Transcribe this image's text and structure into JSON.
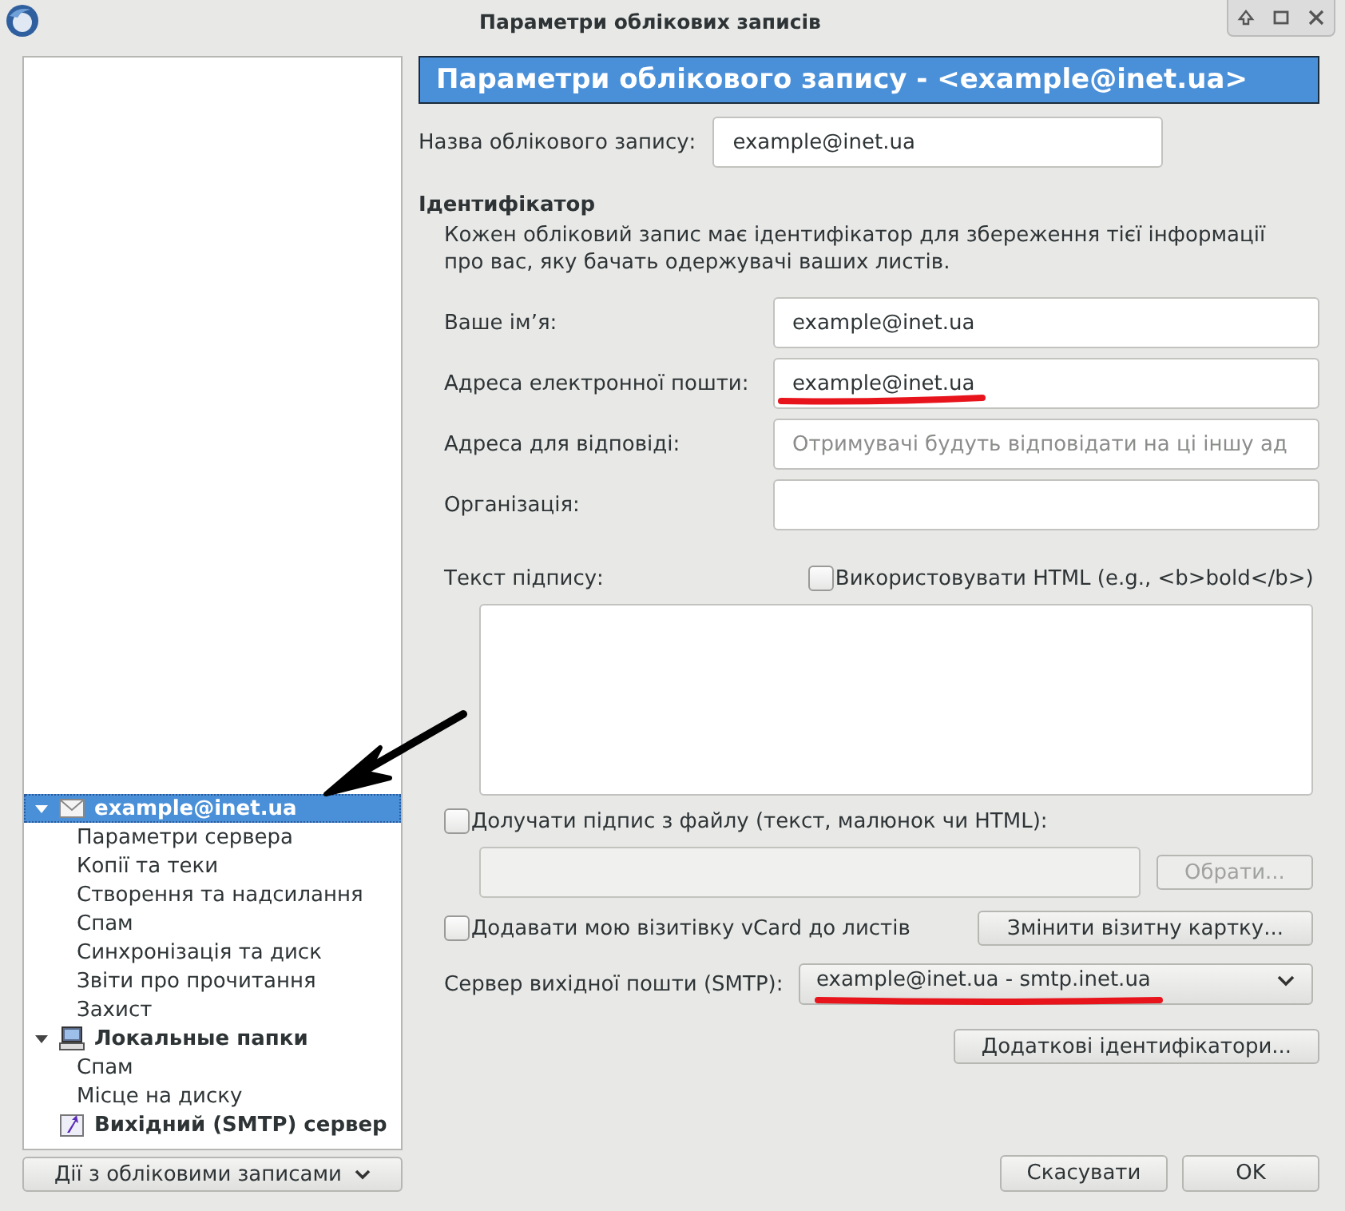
{
  "window": {
    "title": "Параметри облікових записів"
  },
  "tree": [
    {
      "label": "example@inet.ua",
      "kind": "account",
      "selected": true,
      "expanded": true,
      "children": [
        {
          "label": "Параметри сервера",
          "selected": false
        },
        {
          "label": "Копії та теки",
          "selected": false
        },
        {
          "label": "Створення та надсилання",
          "selected": false
        },
        {
          "label": "Спам",
          "selected": false
        },
        {
          "label": "Синхронізація та диск",
          "selected": false
        },
        {
          "label": "Звіти про прочитання",
          "selected": false
        },
        {
          "label": "Захист",
          "selected": false
        }
      ]
    },
    {
      "label": "Локальные папки",
      "kind": "local",
      "selected": false,
      "expanded": true,
      "children": [
        {
          "label": "Спам",
          "selected": false
        },
        {
          "label": "Місце на диску",
          "selected": false
        }
      ]
    },
    {
      "label": "Вихідний (SMTP) сервер",
      "kind": "smtp",
      "selected": false
    }
  ],
  "actions_button": "Дії з обліковими записами",
  "header": "Параметри облікового запису - <example@inet.ua>",
  "account_name": {
    "label": "Назва облікового запису:",
    "value": "example@inet.ua"
  },
  "identity": {
    "heading": "Ідентифікатор",
    "description": "Кожен обліковий запис має ідентифікатор для збереження тієї інформації про вас, яку бачать одержувачі ваших листів.",
    "fields": [
      {
        "label": "Ваше ім’я:",
        "value": "example@inet.ua"
      },
      {
        "label": "Адреса електронної пошти:",
        "value": "example@inet.ua"
      },
      {
        "label": "Адреса для відповіді:",
        "placeholder": "Отримувачі будуть відповідати на ці іншу ад"
      },
      {
        "label": "Організація:"
      }
    ]
  },
  "signature": {
    "label": "Текст підпису:",
    "use_html": {
      "label": "Використовувати HTML (e.g., <b>bold</b>)",
      "checked": false
    }
  },
  "attach_file": {
    "label": "Долучати підпис з файлу (текст, малюнок чи HTML):",
    "checked": false
  },
  "choose_button": {
    "label": "Обрати...",
    "disabled": true
  },
  "vcard": {
    "label": "Додавати мою візитівку vCard до листів",
    "checked": false
  },
  "edit_vcard_button": "Змінити візитну картку...",
  "smtp": {
    "label": "Сервер вихідної пошти (SMTP):",
    "value": "example@inet.ua - smtp.inet.ua"
  },
  "extra_identities_button": "Додаткові ідентифікатори...",
  "buttons": [
    "Скасувати",
    "OK"
  ]
}
